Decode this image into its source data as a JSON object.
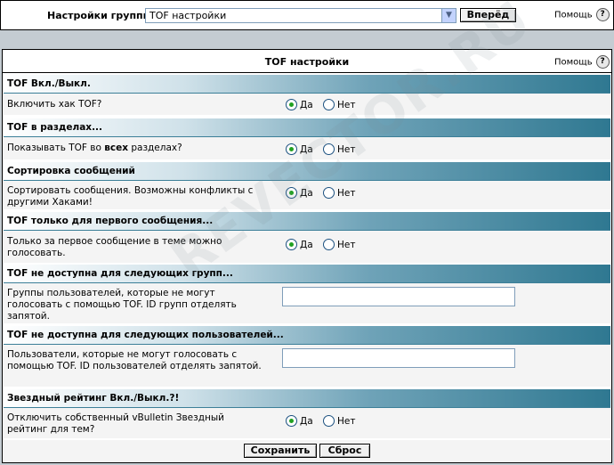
{
  "topbar": {
    "label": "Настройки группы",
    "select_value": "TOF настройки",
    "next_button": "Вперёд",
    "help_label": "Помощь",
    "help_icon": "?"
  },
  "panel": {
    "title": "TOF настройки",
    "help_label": "Помощь",
    "help_icon": "?"
  },
  "sections": [
    {
      "title": "TOF Вкл./Выкл.",
      "description": "Включить хак TOF?",
      "type": "radio",
      "yes": "Да",
      "no": "Нет",
      "selected": "yes"
    },
    {
      "title": "TOF в разделах...",
      "description_pre": "Показывать TOF во ",
      "description_bold": "всех",
      "description_post": " разделах?",
      "type": "radio",
      "yes": "Да",
      "no": "Нет",
      "selected": "yes"
    },
    {
      "title": "Сортировка сообщений",
      "description": "Сортировать сообщения. Возможны конфликты с другими Хаками!",
      "type": "radio",
      "yes": "Да",
      "no": "Нет",
      "selected": "yes"
    },
    {
      "title": "TOF только для первого сообщения...",
      "description": "Только за первое сообщение в теме можно голосовать.",
      "type": "radio",
      "yes": "Да",
      "no": "Нет",
      "selected": "yes"
    },
    {
      "title": "TOF не доступна для следующих групп...",
      "description": "Группы пользователей, которые не могут голосовать с помощью TOF. ID групп отделять запятой.",
      "type": "text",
      "value": ""
    },
    {
      "title": "TOF не доступна для следующих пользователей...",
      "description": "Пользователи, которые не могут голосовать с помощью TOF. ID пользователей отделять запятой.",
      "type": "text",
      "value": ""
    },
    {
      "title": "Звездный рейтинг Вкл./Выкл.?!",
      "description": "Отключить собственный vBulletin Звездный рейтинг для тем?",
      "type": "radio",
      "yes": "Да",
      "no": "Нет",
      "selected": "yes"
    }
  ],
  "footer": {
    "save_button": "Сохранить",
    "reset_button": "Сброс"
  },
  "watermark": "REVECTOR.RU"
}
